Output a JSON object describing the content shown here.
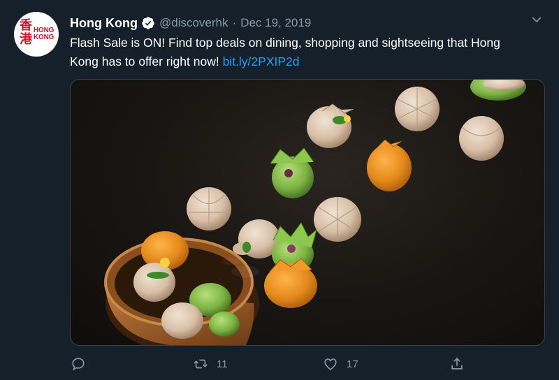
{
  "tweet": {
    "avatar_glyph": "香\n港",
    "avatar_brand": "HONG\nKONG",
    "name": "Hong Kong",
    "handle": "@discoverhk",
    "separator": "·",
    "date": "Dec 19, 2019",
    "text": "Flash Sale is ON! Find top deals on dining, shopping and sightseeing that Hong Kong has to offer right now!",
    "link": "bit.ly/2PXIP2d"
  },
  "actions": {
    "reply_count": "",
    "retweet_count": "11",
    "like_count": "17"
  },
  "icons": {
    "verified": "verified-badge-icon",
    "menu": "chevron-down-icon",
    "reply": "reply-icon",
    "retweet": "retweet-icon",
    "like": "heart-icon",
    "share": "share-icon"
  },
  "colors": {
    "background": "#15202b",
    "text": "#ffffff",
    "muted": "#8899a6",
    "link": "#1da1f2",
    "brand_red": "#d2142b"
  }
}
